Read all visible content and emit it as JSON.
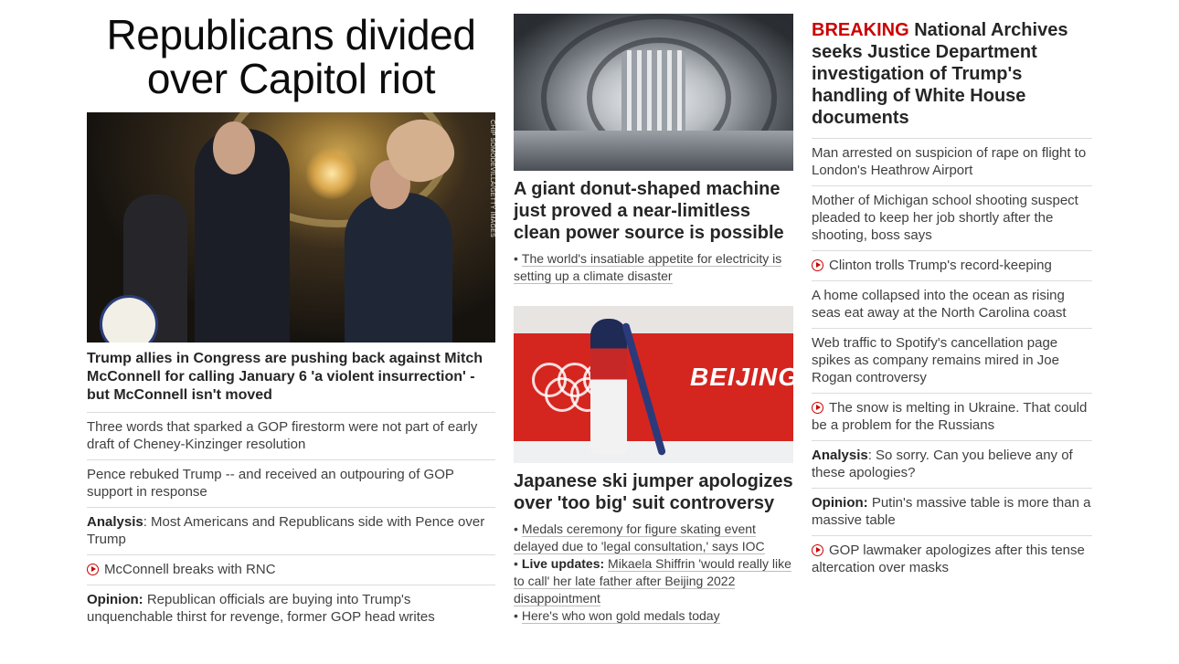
{
  "column1": {
    "headline": "Republicans divided over Capitol riot",
    "image": {
      "credit": "CHIP SOMODEVILLA/GETTY IMAGES",
      "description": "Mitch McConnell at press conference"
    },
    "caption": "Trump allies in Congress are pushing back against Mitch McConnell for calling January 6 'a violent insurrection' - but McConnell isn't moved",
    "links": [
      {
        "tag": "",
        "text": "Three words that sparked a GOP firestorm were not part of early draft of Cheney-Kinzinger resolution",
        "video": false
      },
      {
        "tag": "",
        "text": "Pence rebuked Trump -- and received an outpouring of GOP support in response",
        "video": false
      },
      {
        "tag": "Analysis",
        "sep": ":",
        "text": " Most Americans and Republicans side with Pence over Trump",
        "video": false
      },
      {
        "tag": "",
        "text": "McConnell breaks with RNC",
        "video": true
      },
      {
        "tag": "Opinion:",
        "sep": "",
        "text": " Republican officials are buying into Trump's unquenchable thirst for revenge, former GOP head writes",
        "video": false
      }
    ]
  },
  "column2": {
    "story1": {
      "title": "A giant donut-shaped machine just proved a near-limitless clean power source is possible",
      "links": [
        {
          "text": "The world's insatiable appetite for electricity is setting up a climate disaster"
        }
      ]
    },
    "story2": {
      "image_text": "BEIJING",
      "title": "Japanese ski jumper apologizes over 'too big' suit controversy",
      "links": [
        {
          "prefix": "",
          "text": "Medals ceremony for figure skating event delayed due to 'legal consultation,' says IOC"
        },
        {
          "prefix": "Live updates:",
          "text": "Mikaela Shiffrin 'would really like to call' her late father after Beijing 2022 disappointment"
        },
        {
          "prefix": "",
          "text": "Here's who won gold medals today"
        }
      ]
    }
  },
  "column3": {
    "breaking_label": "BREAKING",
    "breaking_text": "National Archives seeks Justice Department investigation of Trump's handling of White House documents",
    "links": [
      {
        "tag": "",
        "sep": "",
        "text": "Man arrested on suspicion of rape on flight to London's Heathrow Airport",
        "video": false
      },
      {
        "tag": "",
        "sep": "",
        "text": "Mother of Michigan school shooting suspect pleaded to keep her job shortly after the shooting, boss says",
        "video": false
      },
      {
        "tag": "",
        "sep": "",
        "text": "Clinton trolls Trump's record-keeping",
        "video": true
      },
      {
        "tag": "",
        "sep": "",
        "text": "A home collapsed into the ocean as rising seas eat away at the North Carolina coast",
        "video": false
      },
      {
        "tag": "",
        "sep": "",
        "text": "Web traffic to Spotify's cancellation page spikes as company remains mired in Joe Rogan controversy",
        "video": false
      },
      {
        "tag": "",
        "sep": "",
        "text": "The snow is melting in Ukraine. That could be a problem for the Russians",
        "video": true
      },
      {
        "tag": "Analysis",
        "sep": ":",
        "text": " So sorry. Can you believe any of these apologies?",
        "video": false
      },
      {
        "tag": "Opinion:",
        "sep": "",
        "text": " Putin's massive table is more than a massive table",
        "video": false
      },
      {
        "tag": "",
        "sep": "",
        "text": "GOP lawmaker apologizes after this tense altercation over masks",
        "video": true
      }
    ]
  },
  "colors": {
    "breaking": "#cc0000",
    "video_icon": "#cc0000",
    "text": "#404040",
    "heading": "#262626"
  }
}
